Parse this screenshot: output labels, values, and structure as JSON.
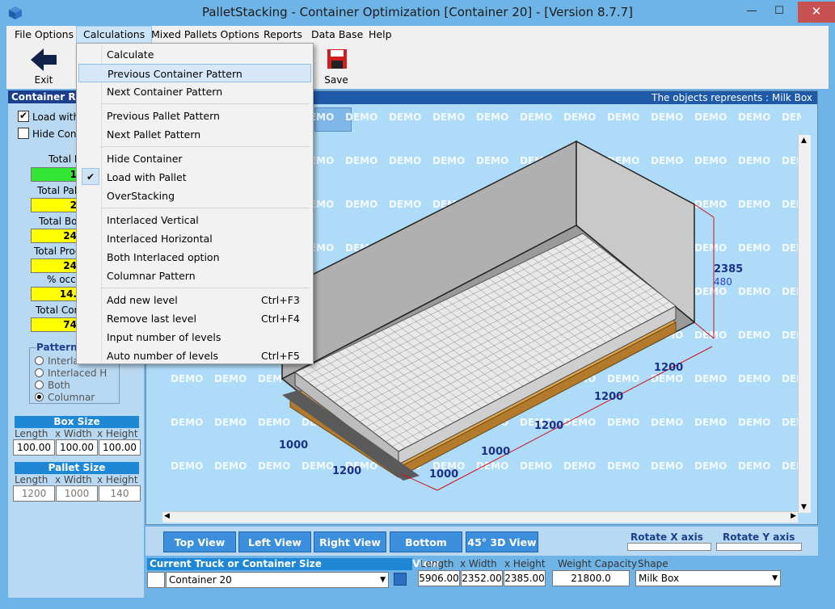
{
  "window": {
    "title": "PalletStacking - Container Optimization [Container 20] - [Version 8.7.7]",
    "minimize": "—",
    "maximize": "☐",
    "close": "✕"
  },
  "menubar": [
    "File Options",
    "Calculations",
    "Mixed Pallets Options",
    "Reports",
    "Data Base",
    "Help"
  ],
  "toolbar": {
    "exit": "Exit",
    "save": "Save"
  },
  "calc_menu": [
    {
      "label": "Calculate",
      "shortcut": ""
    },
    {
      "label": "Previous Container Pattern",
      "shortcut": ""
    },
    {
      "label": "Next Container Pattern",
      "shortcut": ""
    },
    {
      "label": "Previous Pallet Pattern",
      "shortcut": ""
    },
    {
      "label": "Next Pallet Pattern",
      "shortcut": ""
    },
    {
      "label": "Hide Container",
      "shortcut": ""
    },
    {
      "label": "Load with Pallet",
      "shortcut": ""
    },
    {
      "label": "OverStacking",
      "shortcut": ""
    },
    {
      "label": "Interlaced Vertical",
      "shortcut": ""
    },
    {
      "label": "Interlaced Horizontal",
      "shortcut": ""
    },
    {
      "label": "Both Interlaced option",
      "shortcut": ""
    },
    {
      "label": "Columnar Pattern",
      "shortcut": ""
    },
    {
      "label": "Add new level",
      "shortcut": "Ctrl+F3"
    },
    {
      "label": "Remove last level",
      "shortcut": "Ctrl+F4"
    },
    {
      "label": "Input number of levels",
      "shortcut": ""
    },
    {
      "label": "Auto number of levels",
      "shortcut": "Ctrl+F5"
    }
  ],
  "left": {
    "header": "Container Re",
    "load_with": "Load with",
    "hide_cont": "Hide Conta",
    "checkmark": "✔",
    "stats": [
      {
        "label": "Total I",
        "value": "1"
      },
      {
        "label": "Total Pall",
        "value": "2"
      },
      {
        "label": "Total Box",
        "value": "24"
      },
      {
        "label": "Total Prod",
        "value": "24"
      },
      {
        "label": "% occu",
        "value": "14."
      },
      {
        "label": "Total Con",
        "value": "74"
      }
    ],
    "pattern": {
      "title": "Pattern",
      "options": [
        "Interla",
        "Interlaced H",
        "Both",
        "Columnar"
      ]
    },
    "box_size": {
      "title": "Box Size",
      "length": "Length",
      "width": "x Width",
      "height": "x Height",
      "vals": [
        "100.00",
        "100.00",
        "100.00"
      ]
    },
    "pallet_size": {
      "title": "Pallet Size",
      "length": "Length",
      "width": "x Width",
      "height": "x Height",
      "vals": [
        "1200",
        "1000",
        "140"
      ]
    }
  },
  "viewport": {
    "caption": "The objects represents : Milk Box",
    "watermark": "DEMO",
    "dims": {
      "height": "2385",
      "height2": "480",
      "d1200a": "1200",
      "d1200b": "1200",
      "d1200c": "1200",
      "d1000a": "1000",
      "d1000b": "1000",
      "d1000c": "1000",
      "d1200d": "1200"
    }
  },
  "views": [
    "Top View",
    "Left View",
    "Right View",
    "Bottom View",
    "45° 3D View"
  ],
  "rotate": {
    "x": "Rotate X axis",
    "y": "Rotate Y axis"
  },
  "bottom": {
    "container_label": "Current Truck or Container Size",
    "container_value": "Container 20",
    "length": "Length",
    "width": "x Width",
    "height": "x Height",
    "dims": [
      "5906.00",
      "2352.00",
      "2385.00"
    ],
    "weight_label": "Weight Capacity",
    "weight": "21800.0",
    "shape_label": "Shape",
    "shape": "Milk Box"
  }
}
